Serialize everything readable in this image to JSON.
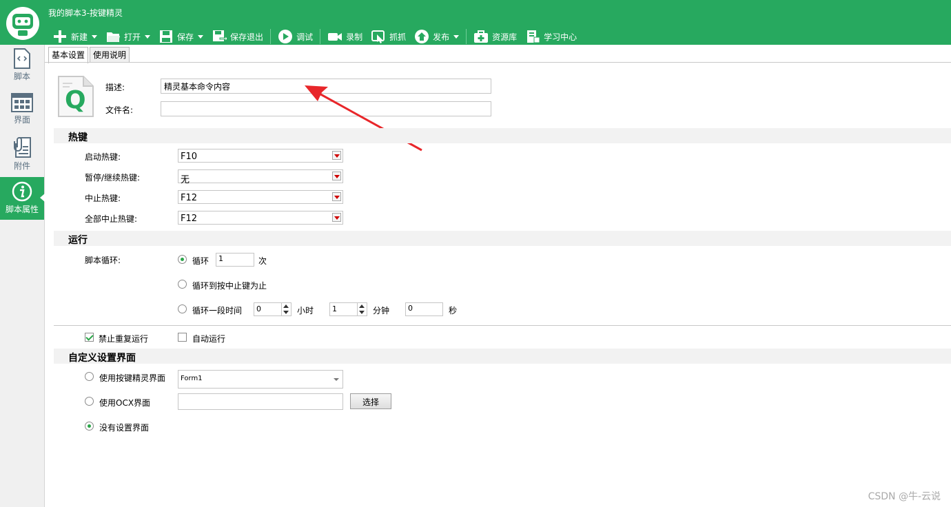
{
  "window": {
    "title": "我的脚本3-按键精灵"
  },
  "toolbar": [
    {
      "label": "新建",
      "icon": "plus-icon",
      "dropdown": true
    },
    {
      "label": "打开",
      "icon": "folder-icon",
      "dropdown": true
    },
    {
      "label": "保存",
      "icon": "save-icon",
      "dropdown": true
    },
    {
      "label": "保存退出",
      "icon": "save-exit-icon",
      "dropdown": false
    },
    {
      "label": "调试",
      "icon": "play-icon",
      "dropdown": false
    },
    {
      "label": "录制",
      "icon": "camera-icon",
      "dropdown": false
    },
    {
      "label": "抓抓",
      "icon": "grab-icon",
      "dropdown": false
    },
    {
      "label": "发布",
      "icon": "publish-icon",
      "dropdown": true
    },
    {
      "label": "资源库",
      "icon": "resource-icon",
      "dropdown": false
    },
    {
      "label": "学习中心",
      "icon": "learn-icon",
      "dropdown": false
    }
  ],
  "sidebar": [
    {
      "label": "脚本",
      "icon": "script-file-icon",
      "active": false
    },
    {
      "label": "界面",
      "icon": "grid-window-icon",
      "active": false
    },
    {
      "label": "附件",
      "icon": "paperclip-icon",
      "active": false
    },
    {
      "label": "脚本属性",
      "icon": "info-icon",
      "active": true
    }
  ],
  "tabs": [
    {
      "label": "基本设置",
      "active": true
    },
    {
      "label": "使用说明",
      "active": false
    }
  ],
  "basic": {
    "desc_label": "描述:",
    "desc_value": "精灵基本命令内容",
    "filename_label": "文件名:",
    "filename_value": ""
  },
  "hotkeys": {
    "title": "热键",
    "rows": [
      {
        "label": "启动热键:",
        "value": "F10"
      },
      {
        "label": "暂停/继续热键:",
        "value": "无"
      },
      {
        "label": "中止热键:",
        "value": "F12"
      },
      {
        "label": "全部中止热键:",
        "value": "F12"
      }
    ]
  },
  "run": {
    "title": "运行",
    "loop_label": "脚本循环:",
    "opt_loop": "循环",
    "loop_count": "1",
    "times_unit": "次",
    "opt_until_stop": "循环到按中止键为止",
    "opt_duration": "循环一段时间",
    "hours": "0",
    "hours_unit": "小时",
    "minutes": "1",
    "minutes_unit": "分钟",
    "seconds": "0",
    "seconds_unit": "秒",
    "forbid_repeat": "禁止重复运行",
    "auto_run": "自动运行"
  },
  "custom_ui": {
    "title": "自定义设置界面",
    "opt_builtin": "使用按键精灵界面",
    "form_value": "Form1",
    "opt_ocx": "使用OCX界面",
    "ocx_value": "",
    "select_btn": "选择",
    "opt_none": "没有设置界面"
  },
  "watermark": "CSDN @牛-云说",
  "colors": {
    "brand": "#27a95f",
    "arrow": "#e8262a"
  }
}
